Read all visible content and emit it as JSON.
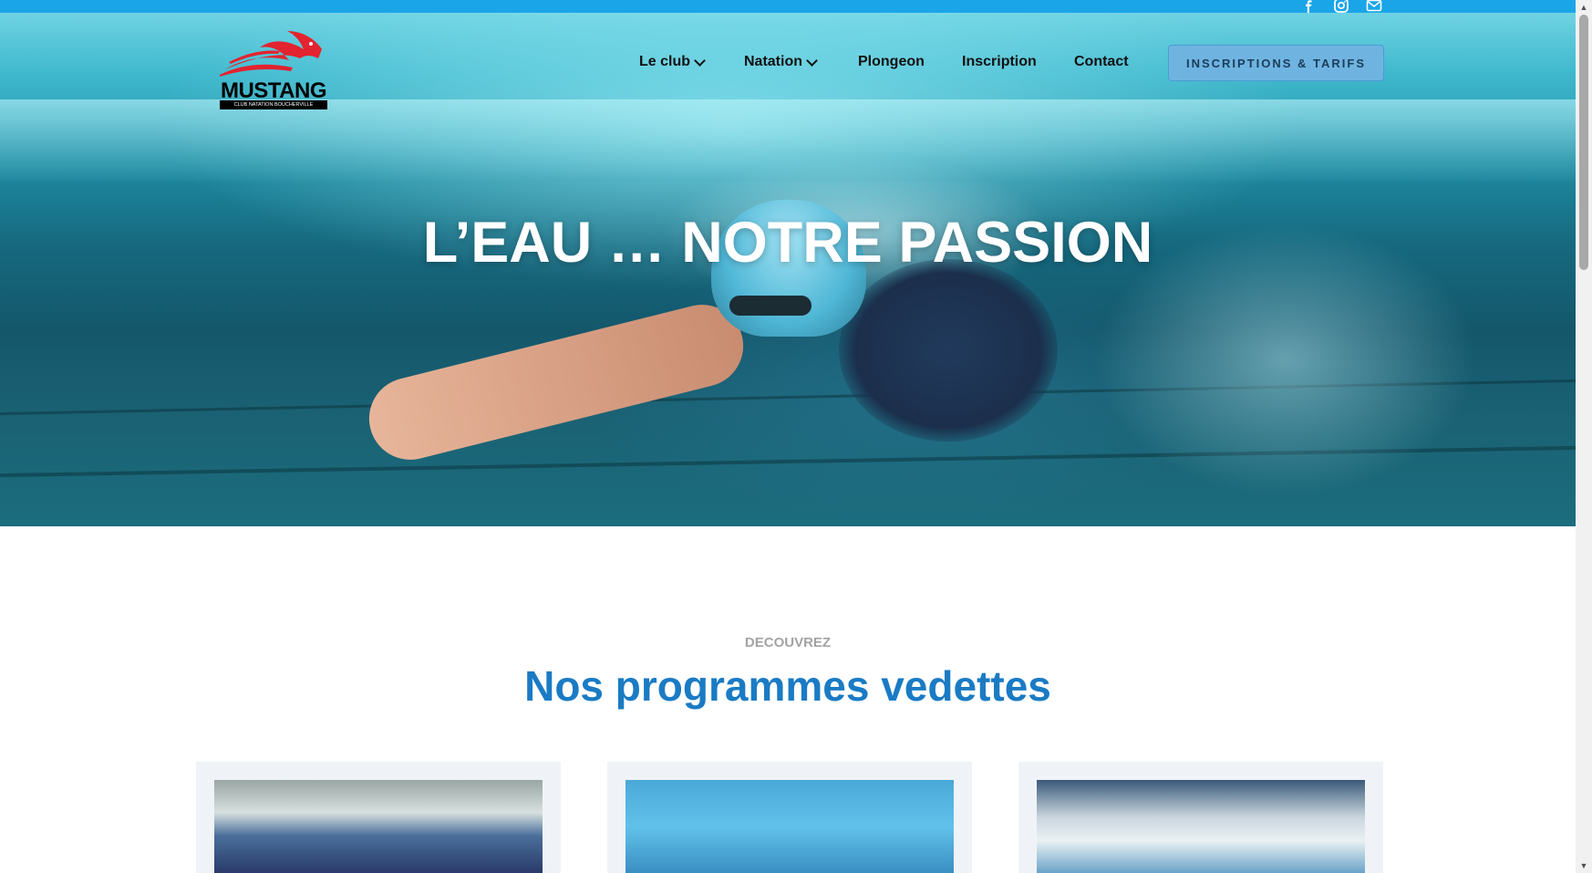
{
  "social": [
    {
      "name": "facebook-icon"
    },
    {
      "name": "instagram-icon"
    },
    {
      "name": "mail-icon"
    }
  ],
  "logo": {
    "wordmark": "MUSTANG",
    "subtitle": "CLUB NATATION BOUCHERVILLE"
  },
  "nav": {
    "items": [
      {
        "label": "Le club",
        "has_dropdown": true
      },
      {
        "label": "Natation",
        "has_dropdown": true
      },
      {
        "label": "Plongeon",
        "has_dropdown": false
      },
      {
        "label": "Inscription",
        "has_dropdown": false
      },
      {
        "label": "Contact",
        "has_dropdown": false
      }
    ],
    "cta_label": "INSCRIPTIONS & TARIFS"
  },
  "hero": {
    "title": "L’EAU … NOTRE PASSION"
  },
  "featured": {
    "eyebrow": "DECOUVREZ",
    "title": "Nos programmes vedettes"
  },
  "colors": {
    "topbar": "#1aa5e8",
    "accent_blue": "#1a7bc4",
    "cta_bg": "#6fb4e1",
    "logo_red": "#e3232f"
  }
}
